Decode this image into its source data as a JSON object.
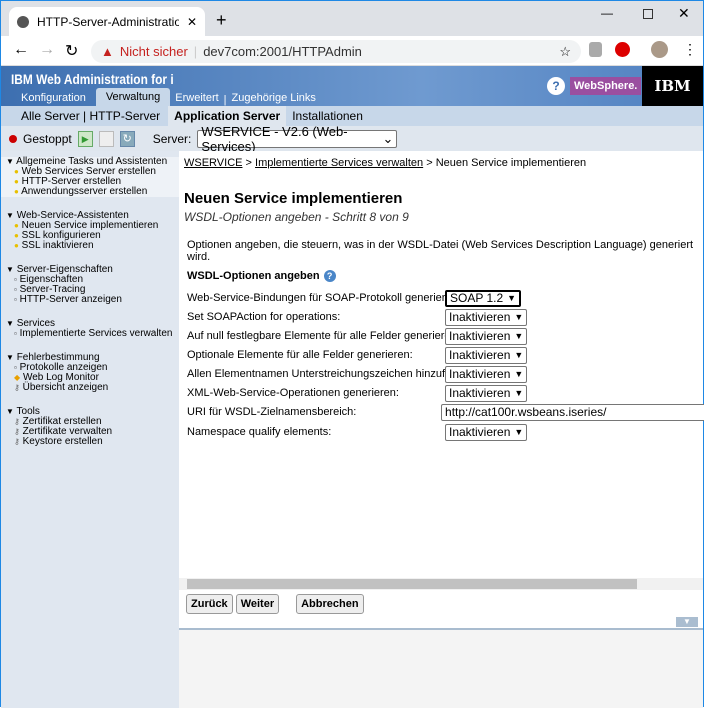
{
  "browser": {
    "tab_title": "HTTP-Server-Administration auf I",
    "security": "Nicht sicher",
    "url": "dev7com:2001/HTTPAdmin"
  },
  "header": {
    "app_title": "IBM Web Administration for i",
    "tabs": [
      "Konfiguration",
      "Verwaltung",
      "Erweitert",
      "Zugehörige Links"
    ],
    "websphere": "WebSphere.",
    "ibm": "IBM"
  },
  "subnav": {
    "items": [
      "Alle Server",
      "HTTP-Server",
      "Application Server",
      "Installationen"
    ]
  },
  "toolbar": {
    "status": "Gestoppt",
    "server_label": "Server:",
    "server_value": "WSERVICE - V2.6 (Web-Services)"
  },
  "sidebar": {
    "groups": [
      {
        "title": "Allgemeine Tasks und Assistenten",
        "items": [
          "Web Services Server erstellen",
          "HTTP-Server erstellen",
          "Anwendungsserver erstellen"
        ]
      },
      {
        "title": "Web-Service-Assistenten",
        "items": [
          "Neuen Service implementieren",
          "SSL konfigurieren",
          "SSL inaktivieren"
        ]
      },
      {
        "title": "Server-Eigenschaften",
        "items": [
          "Eigenschaften",
          "Server-Tracing",
          "HTTP-Server anzeigen"
        ]
      },
      {
        "title": "Services",
        "items": [
          "Implementierte Services verwalten"
        ]
      },
      {
        "title": "Fehlerbestimmung",
        "items": [
          "Protokolle anzeigen",
          "Web Log Monitor",
          "Übersicht anzeigen"
        ]
      },
      {
        "title": "Tools",
        "items": [
          "Zertifikat erstellen",
          "Zertifikate verwalten",
          "Keystore erstellen"
        ]
      }
    ]
  },
  "main": {
    "breadcrumb": [
      "WSERVICE",
      "Implementierte Services verwalten",
      "Neuen Service implementieren"
    ],
    "title": "Neuen Service implementieren",
    "subtitle": "WSDL-Optionen angeben - Schritt 8 von 9",
    "description": "Optionen angeben, die steuern, was in der WSDL-Datei (Web Services Description Language) generiert wird.",
    "section": "WSDL-Optionen angeben",
    "rows": [
      {
        "label": "Web-Service-Bindungen für SOAP-Protokoll generieren:",
        "value": "SOAP 1.2"
      },
      {
        "label": "Set SOAPAction for operations:",
        "value": "Inaktivieren"
      },
      {
        "label": "Auf null festlegbare Elemente für alle Felder generieren:",
        "value": "Inaktivieren"
      },
      {
        "label": "Optionale Elemente für alle Felder generieren:",
        "value": "Inaktivieren"
      },
      {
        "label": "Allen Elementnamen Unterstreichungszeichen hinzufügen:",
        "value": "Inaktivieren"
      },
      {
        "label": "XML-Web-Service-Operationen generieren:",
        "value": "Inaktivieren"
      },
      {
        "label": "URI für WSDL-Zielnamensbereich:",
        "value": "http://cat100r.wsbeans.iseries/"
      },
      {
        "label": "Namespace qualify elements:",
        "value": "Inaktivieren"
      }
    ],
    "buttons": {
      "back": "Zurück",
      "next": "Weiter",
      "cancel": "Abbrechen"
    }
  }
}
